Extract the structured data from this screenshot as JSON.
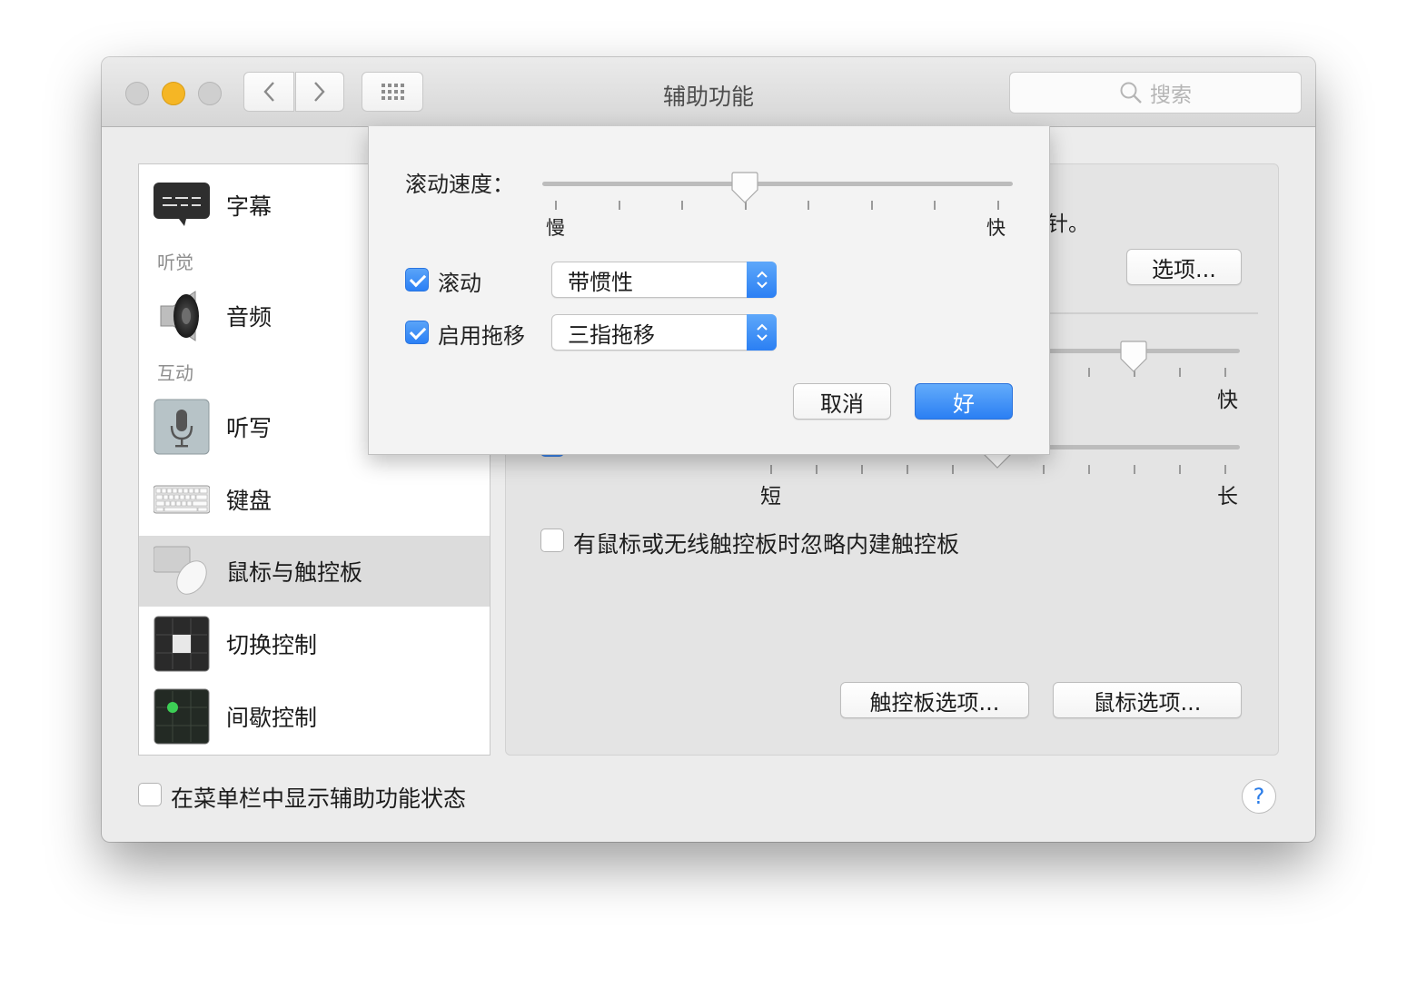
{
  "window": {
    "title": "辅助功能",
    "search_placeholder": "搜索"
  },
  "sidebar": {
    "items": [
      {
        "label": "字幕",
        "icon": "captions-icon"
      },
      {
        "label": "音频",
        "icon": "speaker-icon"
      },
      {
        "label": "听写",
        "icon": "microphone-icon"
      },
      {
        "label": "键盘",
        "icon": "keyboard-icon"
      },
      {
        "label": "鼠标与触控板",
        "icon": "mouse-trackpad-icon",
        "selected": true
      },
      {
        "label": "切换控制",
        "icon": "switch-control-icon"
      },
      {
        "label": "间歇控制",
        "icon": "dwell-control-icon"
      }
    ],
    "sections": {
      "hearing": "听觉",
      "interaction": "互动"
    }
  },
  "right_panel": {
    "partial_text": "针。",
    "options_button": "选项...",
    "slider1_right_label": "快",
    "slider2_left_label": "短",
    "slider2_right_label": "长",
    "ignore_trackpad_label": "有鼠标或无线触控板时忽略内建触控板",
    "ignore_trackpad_checked": false,
    "trackpad_options_button": "触控板选项...",
    "mouse_options_button": "鼠标选项..."
  },
  "footer": {
    "show_status_label": "在菜单栏中显示辅助功能状态",
    "show_status_checked": false,
    "help_label": "?"
  },
  "sheet": {
    "scroll_speed_label": "滚动速度：",
    "speed_slow": "慢",
    "speed_fast": "快",
    "scroll_speed_value": 0.43,
    "scroll_checkbox_label": "滚动",
    "scroll_checked": true,
    "scroll_mode_value": "带惯性",
    "drag_checkbox_label": "启用拖移",
    "drag_checked": true,
    "drag_mode_value": "三指拖移",
    "cancel_button": "取消",
    "ok_button": "好"
  },
  "colors": {
    "accent": "#2b80f5",
    "minimize": "#f5b625"
  }
}
